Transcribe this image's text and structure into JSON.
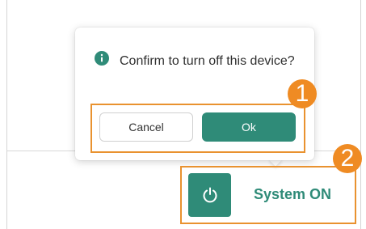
{
  "confirm_dialog": {
    "message": "Confirm to turn off this device?",
    "cancel_label": "Cancel",
    "ok_label": "Ok",
    "icon": "info-icon"
  },
  "annotations": {
    "badge_1": "1",
    "badge_2": "2"
  },
  "device": {
    "power_icon": "power-icon",
    "status_label": "System ON"
  },
  "colors": {
    "accent": "#2f8b78",
    "highlight": "#ef8b23"
  }
}
